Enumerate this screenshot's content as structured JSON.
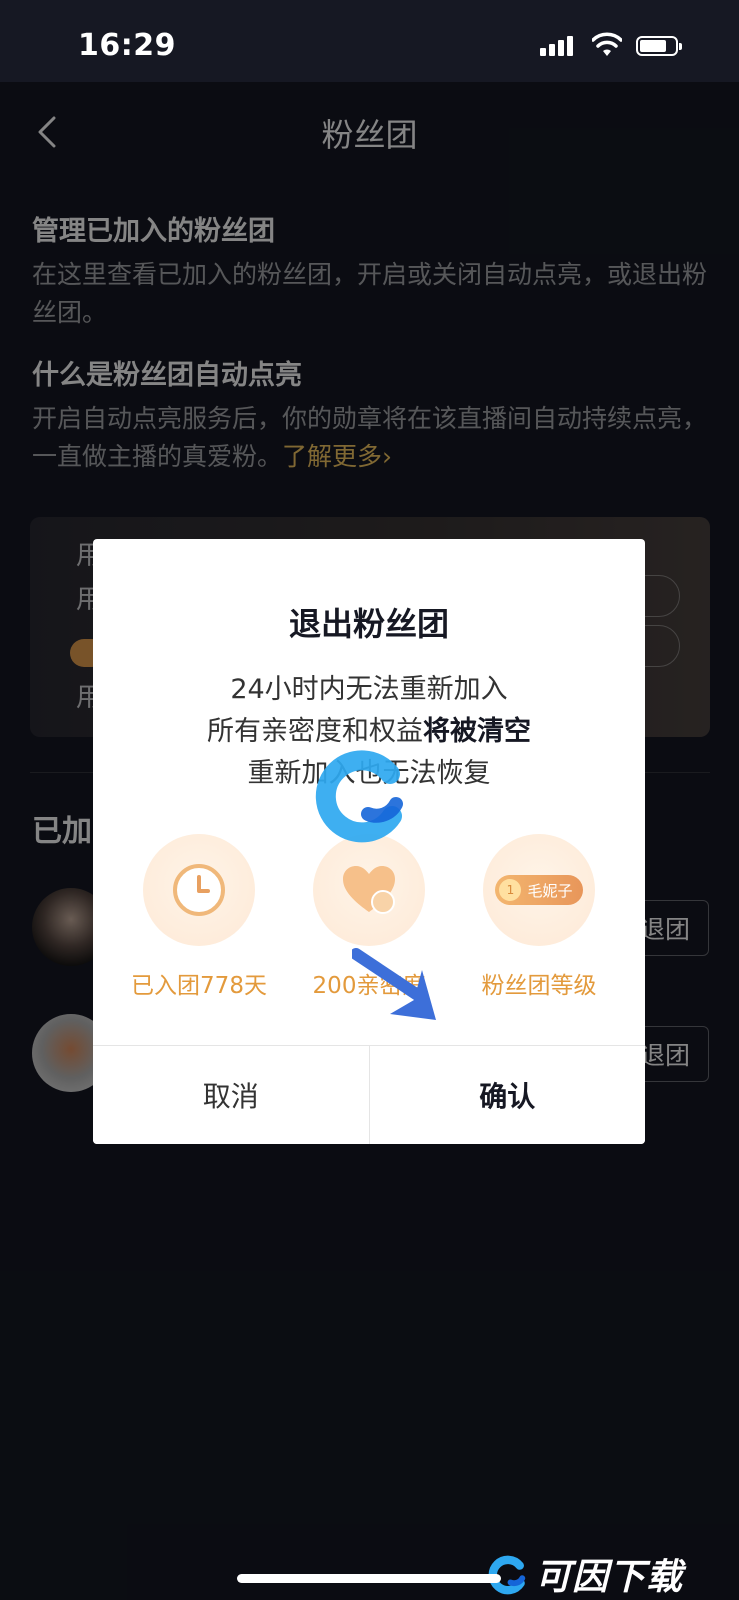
{
  "status_bar": {
    "time": "16:29"
  },
  "nav": {
    "title": "粉丝团"
  },
  "manage": {
    "title": "管理已加入的粉丝团",
    "desc": "在这里查看已加入的粉丝团，开启或关闭自动点亮，或退出粉丝团。"
  },
  "auto_light": {
    "title": "什么是粉丝团自动点亮",
    "desc": "开启自动点亮服务后，你的勋章将在该直播间自动持续点亮，一直做主播的真爱粉。",
    "link": "了解更多›"
  },
  "joined": {
    "title_partial": "已加",
    "exit_label": "退团"
  },
  "dialog": {
    "title": "退出粉丝团",
    "line1": "24小时内无法重新加入",
    "line2_prefix": "所有亲密度和权益",
    "line2_bold": "将被清空",
    "line3": "重新加入也无法恢复",
    "benefits": [
      {
        "icon": "clock-icon",
        "label": "已入团778天"
      },
      {
        "icon": "heart-icon",
        "label": "200亲密度"
      },
      {
        "icon": "level-badge-icon",
        "badge_level": "1",
        "badge_name": "毛妮子",
        "label": "粉丝团等级"
      }
    ],
    "cancel": "取消",
    "confirm": "确认"
  },
  "watermark": {
    "text": "可因下载"
  },
  "colors": {
    "background": "#161823",
    "link": "#f5c862",
    "benefit_label": "#e39a3c"
  }
}
